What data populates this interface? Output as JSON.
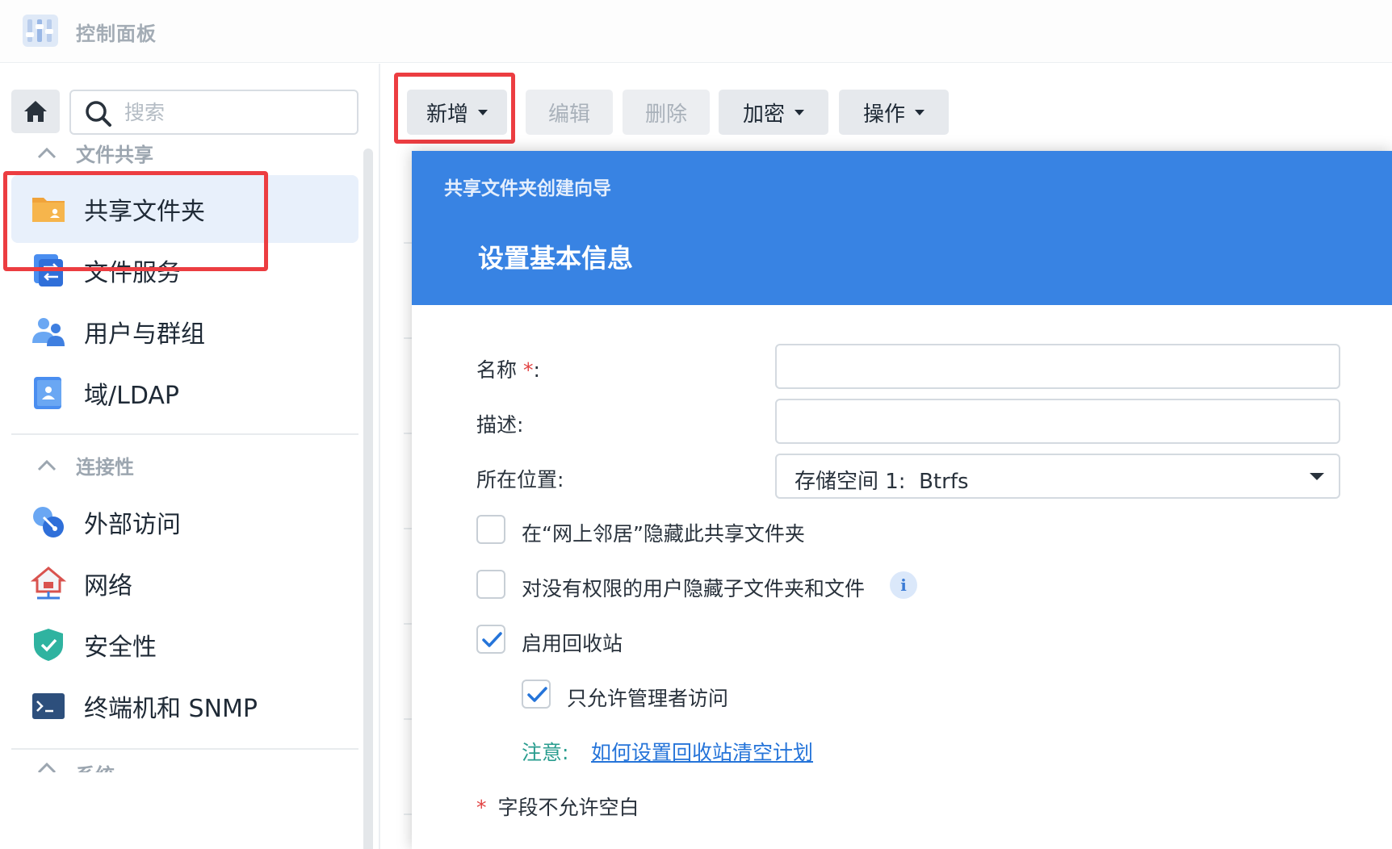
{
  "app": {
    "title": "控制面板"
  },
  "sidebar": {
    "search_placeholder": "搜索",
    "sections": [
      {
        "label": "文件共享",
        "items": [
          {
            "label": "共享文件夹",
            "icon": "shared-folder-icon",
            "active": true
          },
          {
            "label": "文件服务",
            "icon": "file-services-icon"
          },
          {
            "label": "用户与群组",
            "icon": "users-groups-icon"
          },
          {
            "label": "域/LDAP",
            "icon": "domain-ldap-icon"
          }
        ]
      },
      {
        "label": "连接性",
        "items": [
          {
            "label": "外部访问",
            "icon": "external-access-icon"
          },
          {
            "label": "网络",
            "icon": "network-icon"
          },
          {
            "label": "安全性",
            "icon": "security-shield-icon"
          },
          {
            "label": "终端机和 SNMP",
            "icon": "terminal-snmp-icon"
          }
        ]
      },
      {
        "label": "系统"
      }
    ]
  },
  "toolbar": {
    "create_label": "新增",
    "edit_label": "编辑",
    "delete_label": "删除",
    "encrypt_label": "加密",
    "action_label": "操作"
  },
  "dialog": {
    "wizard_title": "共享文件夹创建向导",
    "step_title": "设置基本信息",
    "name_label": "名称",
    "name_required_mark": "*",
    "name_colon": ":",
    "name_value": "",
    "description_label": "描述:",
    "description_value": "",
    "location_label": "所在位置:",
    "location_value": "存储空间 1:  Btrfs",
    "hide_network_label": "在“网上邻居”隐藏此共享文件夹",
    "hide_network_checked": false,
    "hide_subfolders_label": "对没有权限的用户隐藏子文件夹和文件",
    "hide_subfolders_checked": false,
    "info_glyph": "i",
    "recycle_bin_label": "启用回收站",
    "recycle_bin_checked": true,
    "admin_only_label": "只允许管理者访问",
    "admin_only_checked": true,
    "note_label": "注意:",
    "note_link": "如何设置回收站清空计划",
    "required_note_mark": "*",
    "required_note": "字段不允许空白"
  },
  "colors": {
    "accent": "#3883e3",
    "highlight_box": "#ec3d41",
    "link": "#2574d9",
    "note": "#2a9d8f"
  }
}
